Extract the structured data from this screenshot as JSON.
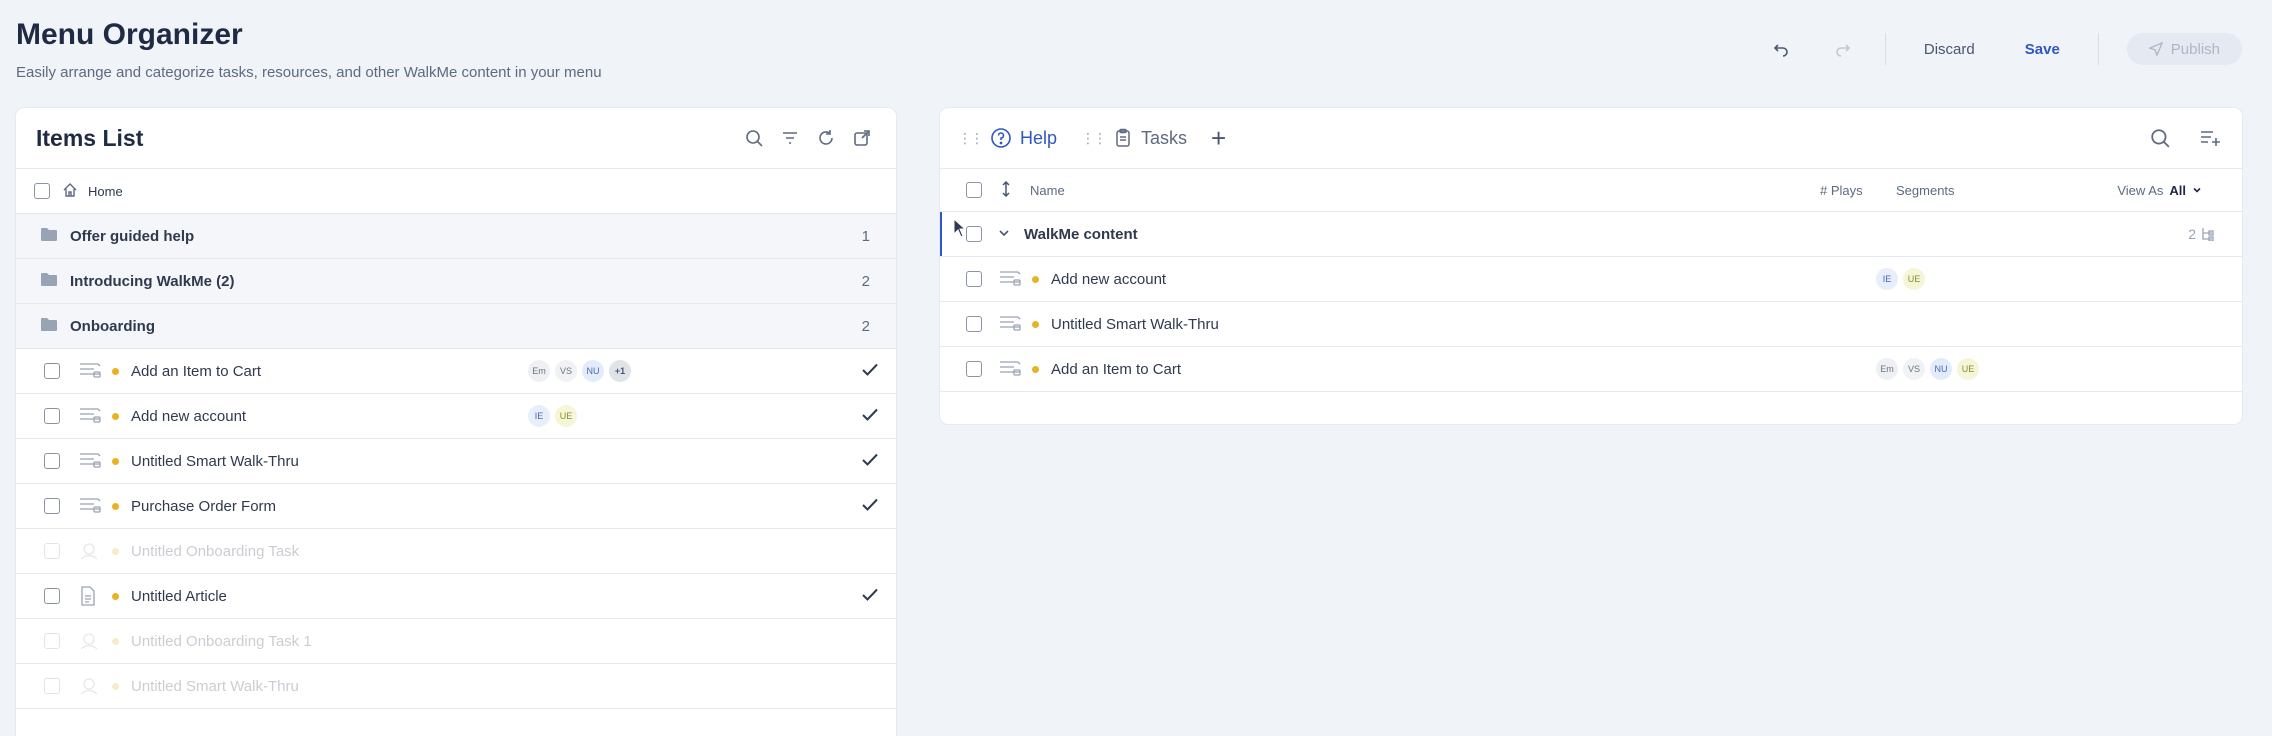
{
  "header": {
    "title": "Menu Organizer",
    "subtitle": "Easily arrange and categorize tasks, resources, and other WalkMe content in your menu"
  },
  "toolbar": {
    "discard_label": "Discard",
    "save_label": "Save",
    "publish_label": "Publish"
  },
  "items_list": {
    "title": "Items List",
    "home_label": "Home",
    "folders": [
      {
        "name": "Offer guided help",
        "count": "1"
      },
      {
        "name": "Introducing WalkMe (2)",
        "count": "2"
      },
      {
        "name": "Onboarding",
        "count": "2"
      }
    ],
    "items": [
      {
        "name": "Add an Item to Cart",
        "segments": [
          "Em",
          "VS",
          "NU",
          "+1"
        ],
        "checked": true,
        "enabled": true,
        "type": "walkthru"
      },
      {
        "name": "Add new account",
        "segments": [
          "IE",
          "UE"
        ],
        "checked": true,
        "enabled": true,
        "type": "walkthru"
      },
      {
        "name": "Untitled Smart Walk-Thru",
        "segments": [],
        "checked": true,
        "enabled": true,
        "type": "walkthru"
      },
      {
        "name": "Purchase Order Form",
        "segments": [],
        "checked": true,
        "enabled": true,
        "type": "walkthru"
      },
      {
        "name": "Untitled Onboarding Task",
        "segments": [],
        "checked": false,
        "enabled": false,
        "type": "task"
      },
      {
        "name": "Untitled Article",
        "segments": [],
        "checked": true,
        "enabled": true,
        "type": "article"
      },
      {
        "name": "Untitled Onboarding Task 1",
        "segments": [],
        "checked": false,
        "enabled": false,
        "type": "task"
      },
      {
        "name": "Untitled Smart Walk-Thru",
        "segments": [],
        "checked": false,
        "enabled": false,
        "type": "task"
      }
    ]
  },
  "menu": {
    "tabs": [
      {
        "label": "Help",
        "active": true
      },
      {
        "label": "Tasks",
        "active": false
      }
    ],
    "columns": {
      "name": "Name",
      "plays": "# Plays",
      "segments": "Segments",
      "view_as_label": "View As",
      "view_as_value": "All"
    },
    "group": {
      "name": "WalkMe content",
      "count": "2"
    },
    "items": [
      {
        "name": "Add new account",
        "segments": [
          "IE",
          "UE"
        ]
      },
      {
        "name": "Untitled Smart Walk-Thru",
        "segments": []
      },
      {
        "name": "Add an Item to Cart",
        "segments": [
          "Em",
          "VS",
          "NU",
          "UE"
        ]
      }
    ]
  },
  "colors": {
    "accent": "#2f57c4",
    "status_dot": "#e7b321",
    "background": "#f0f3f8"
  }
}
